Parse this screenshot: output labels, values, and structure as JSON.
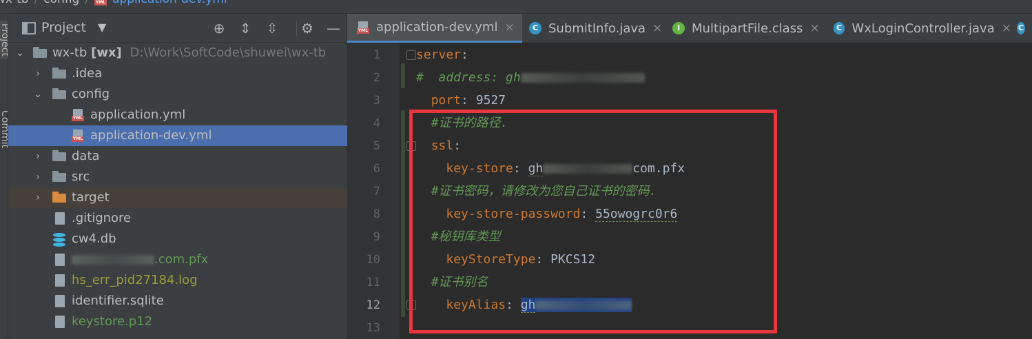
{
  "breadcrumb": {
    "items": [
      "wx-tb",
      "config",
      "application-dev.yml"
    ]
  },
  "toolstrip": {
    "project_tab": "Project",
    "commit_tab": "Commit"
  },
  "project_panel": {
    "title": "Project",
    "tree": [
      {
        "label": "wx-tb",
        "badge": "[wx]",
        "path": "D:\\Work\\SoftCode\\shuwei\\wx-tb"
      },
      {
        "label": ".idea"
      },
      {
        "label": "config"
      },
      {
        "label": "application.yml"
      },
      {
        "label": "application-dev.yml"
      },
      {
        "label": "data"
      },
      {
        "label": "src"
      },
      {
        "label": "target"
      },
      {
        "label": ".gitignore"
      },
      {
        "label": "cw4.db"
      },
      {
        "label": ".com.pfx"
      },
      {
        "label": "hs_err_pid27184.log"
      },
      {
        "label": "identifier.sqlite"
      },
      {
        "label": "keystore.p12"
      }
    ]
  },
  "tabs": [
    {
      "label": "application-dev.yml",
      "icon": "yml-icon"
    },
    {
      "label": "SubmitInfo.java",
      "icon": "C"
    },
    {
      "label": "MultipartFile.class",
      "icon": "I"
    },
    {
      "label": "WxLoginController.java",
      "icon": "C"
    }
  ],
  "editor": {
    "line_numbers": [
      "1",
      "2",
      "3",
      "4",
      "5",
      "6",
      "7",
      "8",
      "9",
      "10",
      "11",
      "12",
      "13"
    ],
    "lines": {
      "l1_key": "server",
      "l2_comment": "#  address: gh",
      "l3_key": "port",
      "l3_value": "9527",
      "l4_comment": "#证书的路径.",
      "l5_key": "ssl",
      "l6_key": "key-store",
      "l6_value_start": "gh",
      "l6_value_end": "com.pfx",
      "l7_comment": "#证书密码，请修改为您自己证书的密码.",
      "l8_key": "key-store-password",
      "l8_value": "55owogrc0r6",
      "l9_comment": "#秘钥库类型",
      "l10_key": "keyStoreType",
      "l10_value": "PKCS12",
      "l11_comment": "#证书别名",
      "l12_key": "keyAlias",
      "l12_value": "gh"
    }
  },
  "colors": {
    "highlight_box": "#e8363d",
    "selection": "#4b6eaf"
  }
}
